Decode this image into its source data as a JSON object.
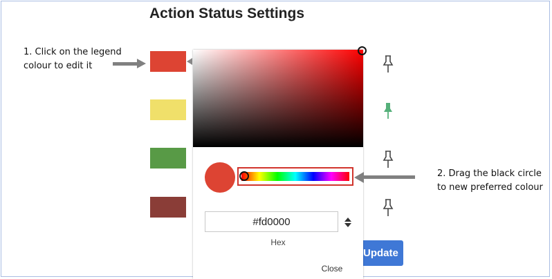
{
  "title": "Action Status Settings",
  "annotations": {
    "step1_line1": "1. Click on the legend",
    "step1_line2": "colour to edit it",
    "step2_line1": "2. Drag the black circle",
    "step2_line2": "to new preferred colour"
  },
  "legend_swatches": [
    {
      "color": "#dd4433"
    },
    {
      "color": "#f0e06a"
    },
    {
      "color": "#589a46"
    },
    {
      "color": "#8a3d37"
    }
  ],
  "pins": [
    {
      "icon": "pin-icon",
      "color": "#444444"
    },
    {
      "icon": "pin-icon",
      "color": "#55b07a"
    },
    {
      "icon": "pin-icon",
      "color": "#444444"
    },
    {
      "icon": "pin-icon",
      "color": "#444444"
    }
  ],
  "update_button": {
    "label": "Update",
    "color": "#3f78d6"
  },
  "color_picker": {
    "base_color": "#fd0000",
    "preview_color": "#dd4433",
    "hex_value": "#fd0000",
    "mode_label": "Hex",
    "close_label": "Close",
    "highlight_color": "#d1342c"
  },
  "arrow_color": "#808080"
}
